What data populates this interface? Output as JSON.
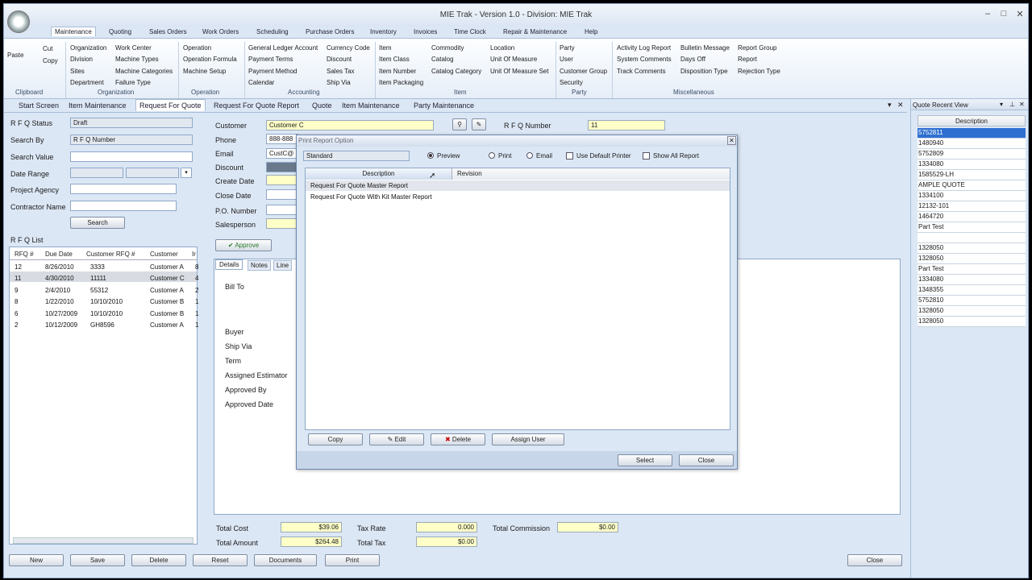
{
  "window": {
    "title": "MIE Trak - Version 1.0 - Division:  MIE Trak",
    "minimize": "–",
    "maximize": "□",
    "close": "✕"
  },
  "ribbon_tabs": [
    "Maintenance",
    "Quoting",
    "Sales Orders",
    "Work Orders",
    "Scheduling",
    "Purchase Orders",
    "Inventory",
    "Invoices",
    "Time Clock",
    "Repair & Maintenance",
    "Help"
  ],
  "ribbon": {
    "clipboard": {
      "paste": "Paste",
      "cut": "Cut",
      "copy": "Copy",
      "group": "Clipboard"
    },
    "organization": {
      "items": [
        "Organization",
        "Division",
        "Sites",
        "Department"
      ],
      "items2": [
        "Work Center",
        "Machine Types",
        "Machine Categories",
        "Failure Type"
      ],
      "group": "Organization"
    },
    "operation": {
      "items": [
        "Operation",
        "Operation Formula",
        "Machine Setup"
      ],
      "group": "Operation"
    },
    "accounting": {
      "items": [
        "General Ledger Account",
        "Payment Terms",
        "Payment Method",
        "Calendar"
      ],
      "items2": [
        "Currency Code",
        "Discount",
        "Sales Tax",
        "Ship Via"
      ],
      "group": "Accounting"
    },
    "item": {
      "items": [
        "Item",
        "Item Class",
        "Item Number",
        "Item Packaging"
      ],
      "items2": [
        "Commodity",
        "Catalog",
        "Catalog Category"
      ],
      "items3": [
        "Location",
        "Unit Of Measure",
        "Unit Of Measure Set"
      ],
      "group": "Item"
    },
    "party": {
      "items": [
        "Party",
        "User",
        "Customer Group",
        "Security"
      ],
      "group": "Party"
    },
    "misc": {
      "items": [
        "Activity Log Report",
        "System Comments",
        "Track Comments"
      ],
      "items2": [
        "Bulletin Message",
        "Days Off",
        "Disposition Type"
      ],
      "items3": [
        "Report Group",
        "Report",
        "Rejection Type"
      ],
      "group": "Miscellaneous"
    }
  },
  "doc_tabs": [
    "Start Screen",
    "Item Maintenance",
    "Request For Quote",
    "Request For Quote Report",
    "Quote",
    "Item Maintenance",
    "Party Maintenance"
  ],
  "doc_tab_controls": {
    "list": "▾",
    "close": "✕"
  },
  "search": {
    "rfq_status_label": "R F Q Status",
    "rfq_status": "Draft",
    "search_by_label": "Search By",
    "search_by": "R F Q Number",
    "search_value_label": "Search Value",
    "date_range_label": "Date Range",
    "project_agency_label": "Project Agency",
    "contractor_label": "Contractor Name",
    "search_button": "Search"
  },
  "rfq_list": {
    "title": "R F Q List",
    "columns": [
      "RFQ #",
      "Due Date",
      "Customer RFQ #",
      "Customer",
      "Ir"
    ],
    "rows": [
      [
        "12",
        "8/26/2010",
        "3333",
        "Customer A",
        "8"
      ],
      [
        "11",
        "4/30/2010",
        "11111",
        "Customer C",
        "4"
      ],
      [
        "9",
        "2/4/2010",
        "55312",
        "Customer A",
        "2"
      ],
      [
        "8",
        "1/22/2010",
        "10/10/2010",
        "Customer B",
        "1"
      ],
      [
        "6",
        "10/27/2009",
        "10/10/2010",
        "Customer B",
        "1"
      ],
      [
        "2",
        "10/12/2009",
        "GH8596",
        "Customer A",
        "1"
      ]
    ]
  },
  "form": {
    "customer_label": "Customer",
    "customer": "Customer C",
    "phone_label": "Phone",
    "phone": "888-888",
    "email_label": "Email",
    "email": "CustC@",
    "discount_label": "Discount",
    "create_date_label": "Create Date",
    "close_date_label": "Close Date",
    "po_label": "P.O. Number",
    "salesperson_label": "Salesperson",
    "rfq_number_label": "R F Q Number",
    "rfq_number": "11",
    "approve_button": "Approve"
  },
  "detail_tabs": [
    "Details",
    "Notes",
    "Line"
  ],
  "details": {
    "labels": [
      "Bill To",
      "Buyer",
      "Ship Via",
      "Term",
      "Assigned Estimator",
      "Approved By",
      "Approved Date"
    ]
  },
  "totals": {
    "total_cost_label": "Total Cost",
    "total_cost": "$39.06",
    "total_amount_label": "Total Amount",
    "total_amount": "$264.48",
    "tax_rate_label": "Tax Rate",
    "tax_rate": "0.000",
    "total_tax_label": "Total Tax",
    "total_tax": "$0.00",
    "total_commission_label": "Total Commission",
    "total_commission": "$0.00"
  },
  "footer": {
    "new": "New",
    "save": "Save",
    "delete": "Delete",
    "reset": "Reset",
    "documents": "Documents",
    "print": "Print",
    "close": "Close"
  },
  "dialog": {
    "title": "Print Report Option",
    "close": "✕",
    "report_group": "Standard",
    "preview": "Preview",
    "print": "Print",
    "email": "Email",
    "use_default_printer": "Use Default Printer",
    "show_all_report": "Show All Report",
    "columns": [
      "Description",
      "Revision"
    ],
    "rows": [
      "Request For Quote Master Report",
      "Request For Quote With Kit Master Report"
    ],
    "copy": "Copy",
    "edit": "Edit",
    "delete": "Delete",
    "assign_user": "Assign User",
    "select": "Select",
    "close_btn": "Close"
  },
  "recent": {
    "title": "Quote Recent View",
    "header": "Description",
    "rows": [
      "5752811",
      "1480940",
      "5752809",
      "1334080",
      "1585529-LH",
      "AMPLE QUOTE",
      "1334100",
      "12132-101",
      "1464720",
      "Part Test",
      "",
      "1328050",
      "1328050",
      "Part Test",
      "1334080",
      "1348355",
      "5752810",
      "1328050",
      "1328050"
    ]
  }
}
